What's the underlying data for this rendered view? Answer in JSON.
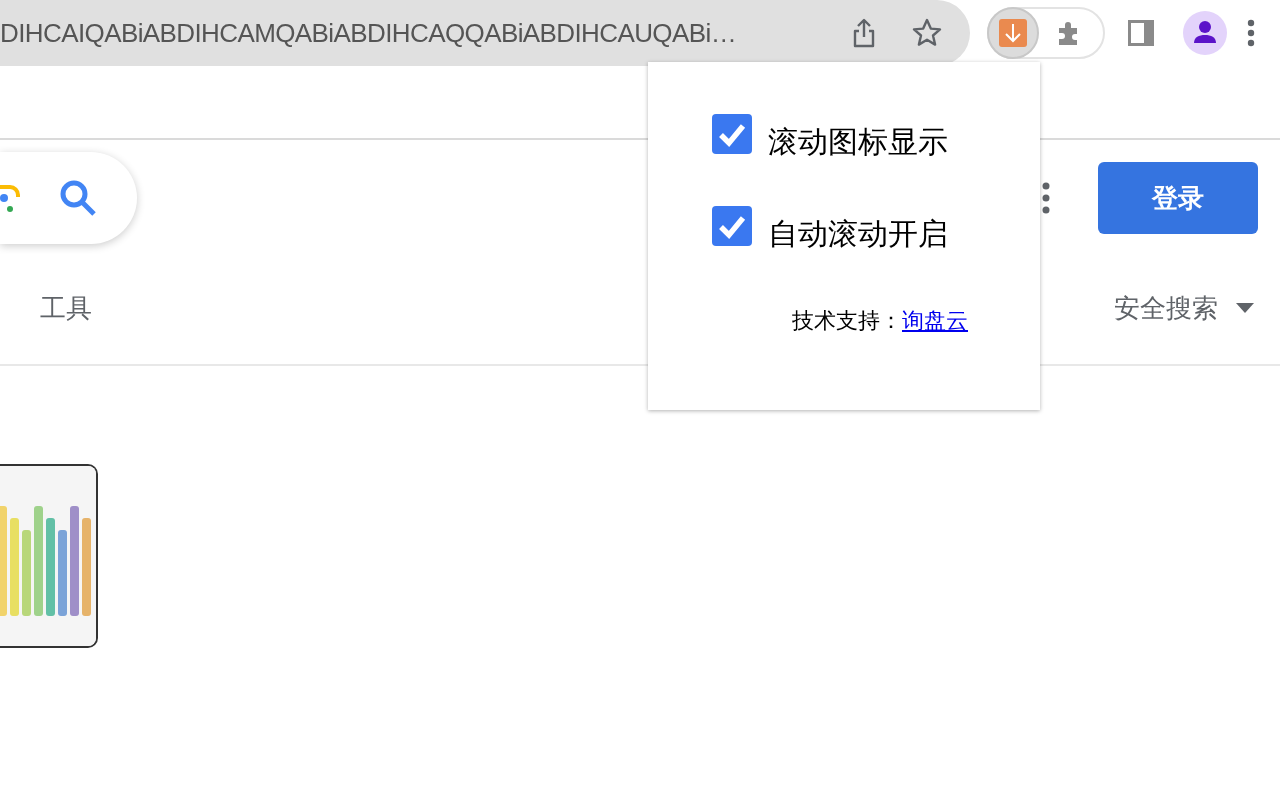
{
  "address_bar": {
    "url": "DIHCAIQABiABDIHCAMQABiABDIHCAQQABiABDIHCAUQABi…"
  },
  "header": {
    "login_button": "登录"
  },
  "tools_row": {
    "tools": "工具",
    "safe_search": "安全搜索"
  },
  "popup": {
    "options": [
      {
        "label": "滚动图标显示",
        "checked": true
      },
      {
        "label": "自动滚动开启",
        "checked": true
      }
    ],
    "support_label": "技术支持：",
    "support_link": "询盘云"
  }
}
